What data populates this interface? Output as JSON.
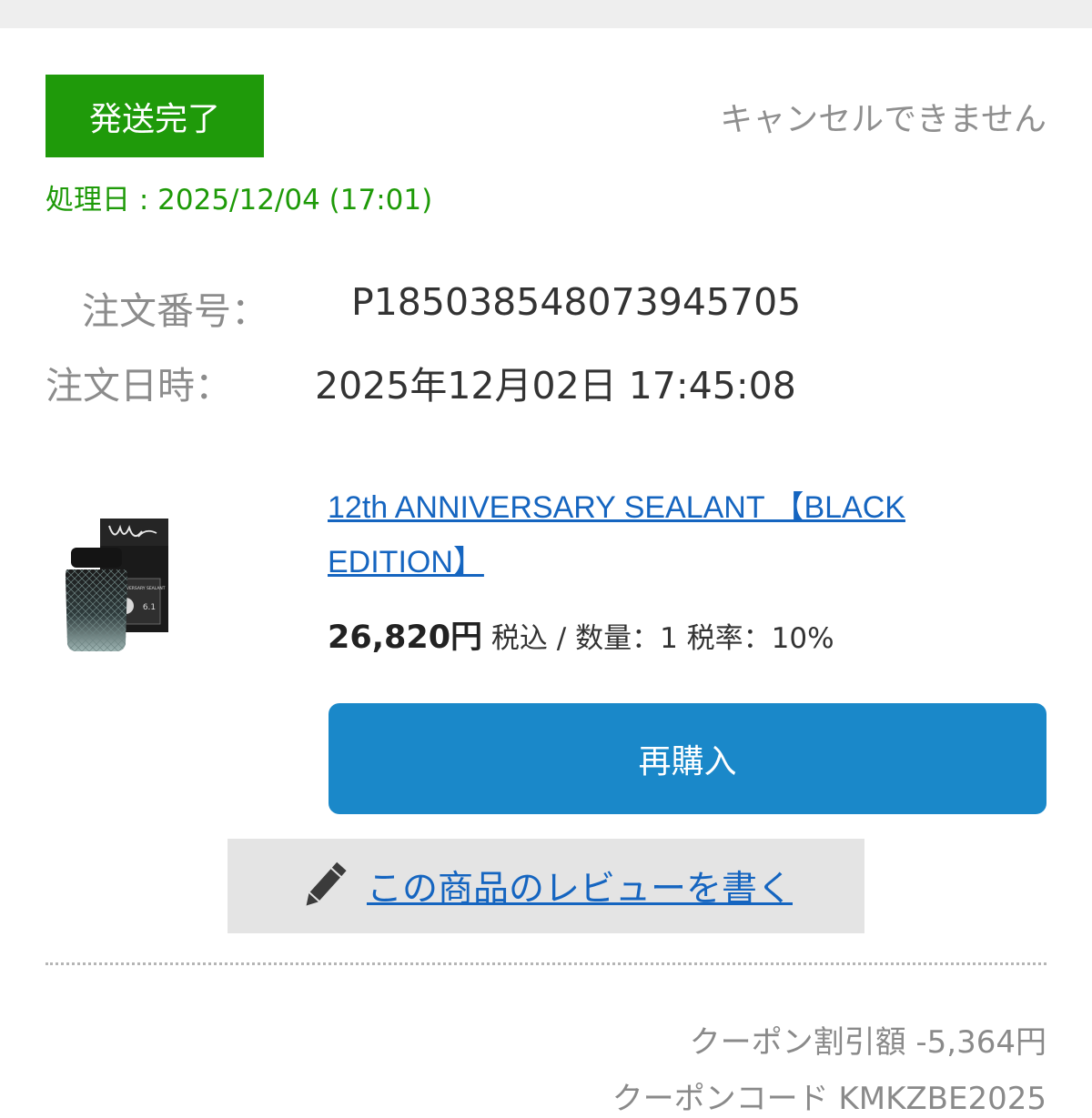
{
  "order": {
    "status_badge": "発送完了",
    "cancel_note": "キャンセルできません",
    "processed_date": "処理日 : 2025/12/04 (17:01)",
    "order_number_label": "注文番号：",
    "order_number": "P185038548073945705",
    "order_datetime_label": "注文日時：",
    "order_datetime": "2025年12月02日 17:45:08"
  },
  "product": {
    "name": "12th ANNIVERSARY SEALANT 【BLACK EDITION】",
    "price": "26,820円",
    "price_details": " 税込 / 数量：1 税率：10%",
    "box_label": "12TH ANNIVERSARY SEALANT",
    "box_volume": "6.1"
  },
  "actions": {
    "rebuy_label": "再購入",
    "review_label": "この商品のレビューを書く"
  },
  "summary": {
    "coupon_discount": "クーポン割引額 -5,364円",
    "coupon_code": "クーポンコード KMKZBE2025"
  },
  "icons": {
    "review": "pencil-icon",
    "product": "product-image"
  },
  "colors": {
    "status_green": "#1f9a0a",
    "link_blue": "#1565c0",
    "button_blue": "#1a88c9"
  }
}
